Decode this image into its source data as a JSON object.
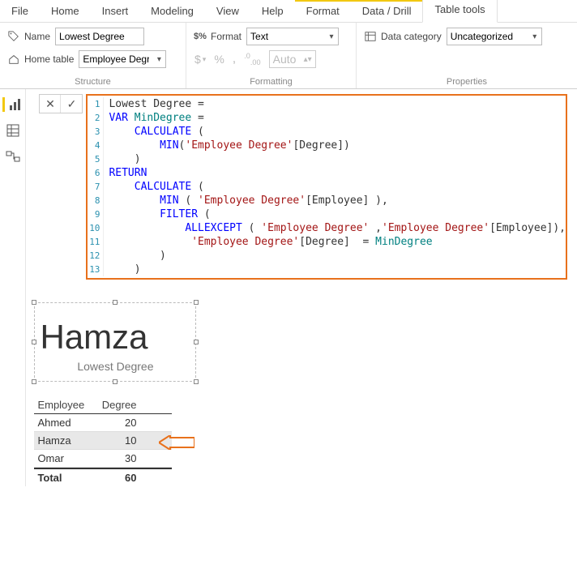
{
  "ribbon": {
    "tabs": [
      "File",
      "Home",
      "Insert",
      "Modeling",
      "View",
      "Help"
    ],
    "contextual_tabs": [
      "Format",
      "Data / Drill",
      "Table tools"
    ],
    "active_tab": "Table tools"
  },
  "structure_group": {
    "label": "Structure",
    "name_label": "Name",
    "name_value": "Lowest Degree",
    "home_table_label": "Home table",
    "home_table_value": "Employee Degree"
  },
  "formatting_group": {
    "label": "Formatting",
    "format_label": "Format",
    "format_value": "Text",
    "auto_placeholder": "Auto",
    "currency": "$",
    "percent": "%",
    "comma": ",",
    "decimals": ".00"
  },
  "properties_group": {
    "label": "Properties",
    "category_label": "Data category",
    "category_value": "Uncategorized"
  },
  "dax": {
    "lines": [
      "Lowest Degree =",
      "VAR MinDegree =",
      "    CALCULATE (",
      "        MIN('Employee Degree'[Degree])",
      "    )",
      "RETURN",
      "    CALCULATE (",
      "        MIN ( 'Employee Degree'[Employee] ),",
      "        FILTER (",
      "            ALLEXCEPT ( 'Employee Degree' ,'Employee Degree'[Employee]),",
      "             'Employee Degree'[Degree]  = MinDegree",
      "        )",
      "    )"
    ]
  },
  "card": {
    "value": "Hamza",
    "caption": "Lowest Degree"
  },
  "table": {
    "columns": [
      "Employee",
      "Degree"
    ],
    "rows": [
      {
        "employee": "Ahmed",
        "degree": 20,
        "highlight": false
      },
      {
        "employee": "Hamza",
        "degree": 10,
        "highlight": true
      },
      {
        "employee": "Omar",
        "degree": 30,
        "highlight": false
      }
    ],
    "total_label": "Total",
    "total_value": 60
  },
  "chart_data": {
    "type": "table",
    "columns": [
      "Employee",
      "Degree"
    ],
    "rows": [
      [
        "Ahmed",
        20
      ],
      [
        "Hamza",
        10
      ],
      [
        "Omar",
        30
      ]
    ],
    "total": [
      "Total",
      60
    ]
  }
}
